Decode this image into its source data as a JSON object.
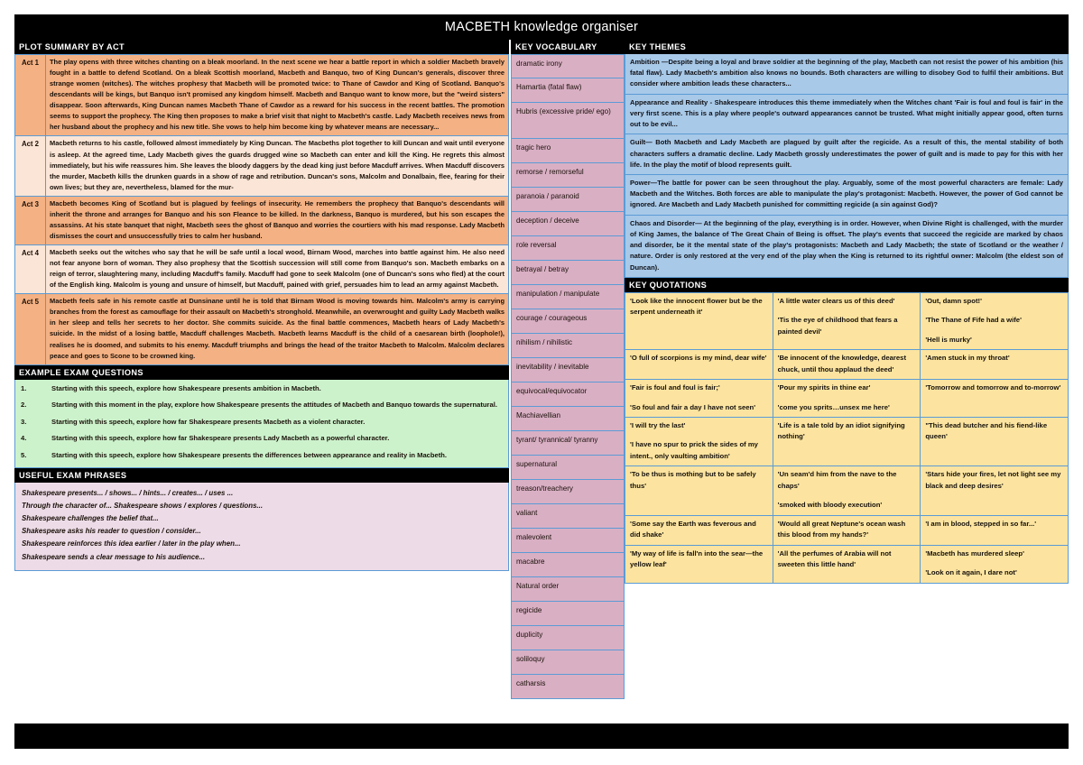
{
  "document": {
    "title": "MACBETH knowledge organiser"
  },
  "plot": {
    "heading": "PLOT SUMMARY BY ACT",
    "acts": [
      {
        "label": "Act 1",
        "text": "The play opens with three witches chanting on a bleak moorland. In the next scene we hear a battle report in which a soldier Macbeth bravely fought in a battle to defend Scotland. On a bleak Scottish moorland, Macbeth and Banquo, two of King Duncan's generals, discover three strange women (witches). The witches prophesy that Macbeth will be promoted twice: to Thane of Cawdor and King of Scotland. Banquo's descendants will be kings, but Banquo isn't promised any kingdom himself. Macbeth and Banquo want to know more, but the \"weird sisters\" disappear. Soon afterwards, King Duncan names Macbeth Thane of Cawdor as a reward for his success in the recent battles. The promotion seems to support the prophecy. The King then proposes to make a brief visit that night to Macbeth's castle. Lady Macbeth receives news from her husband about the prophecy and his new title. She vows to help him become king by whatever means are necessary..."
      },
      {
        "label": "Act 2",
        "text": "Macbeth returns to his castle, followed almost immediately by King Duncan. The Macbeths plot together to kill Duncan and wait until everyone is asleep. At the agreed time, Lady Macbeth gives the guards drugged wine so Macbeth can enter and kill the King. He regrets this almost immediately, but his wife reassures him. She leaves the bloody daggers by the dead king just before Macduff arrives. When Macduff discovers the murder, Macbeth kills the drunken guards in a show of rage and retribution. Duncan's sons, Malcolm and Donalbain, flee, fearing for their own lives; but they are, nevertheless, blamed for the mur-"
      },
      {
        "label": "Act 3",
        "text": "Macbeth becomes King of Scotland but is plagued by feelings of insecurity. He remembers the prophecy that Banquo's descendants will inherit the throne and arranges for Banquo and his son Fleance to be killed. In the darkness, Banquo is murdered, but his son escapes the assassins. At his state banquet that night, Macbeth sees the ghost of Banquo and worries the courtiers with his mad response. Lady Macbeth dismisses the court and unsuccessfully tries to calm her husband."
      },
      {
        "label": "Act 4",
        "text": "Macbeth seeks out the witches who say that he will be safe until a local wood, Birnam Wood, marches into battle against him. He also need not fear anyone born of woman. They also prophesy that the Scottish succession will still come from Banquo's son. Macbeth embarks on a reign of terror, slaughtering many, including Macduff's family. Macduff had gone to seek Malcolm (one of Duncan's sons who fled) at the court of the English king. Malcolm is young and unsure of himself, but Macduff, pained with grief, persuades him to lead an army against Macbeth."
      },
      {
        "label": "Act 5",
        "text": "Macbeth feels safe in his remote castle at Dunsinane until he is told that Birnam Wood is moving towards him. Malcolm's army is carrying branches from the forest as camouflage for their assault on Macbeth's stronghold. Meanwhile, an overwrought and guilty Lady Macbeth walks in her sleep and tells her secrets to her doctor. She commits suicide. As the final battle commences, Macbeth hears of Lady Macbeth's suicide. In the midst of a losing battle, Macduff challenges Macbeth. Macbeth learns Macduff is the child of a caesarean birth (loophole!), realises he is doomed, and submits to his enemy. Macduff triumphs and brings the head of the traitor Macbeth to Malcolm. Malcolm declares peace and goes to Scone to be crowned king."
      }
    ]
  },
  "exam_questions": {
    "heading": "EXAMPLE EXAM QUESTIONS",
    "items": [
      {
        "num": "1.",
        "text": "Starting with this speech, explore how Shakespeare presents ambition in Macbeth."
      },
      {
        "num": "2.",
        "text": "Starting with this moment in the play, explore how Shakespeare presents the attitudes of Macbeth and Banquo towards the supernatural."
      },
      {
        "num": "3.",
        "text": "Starting with this speech, explore how far Shakespeare presents Macbeth as a violent character."
      },
      {
        "num": "4.",
        "text": "Starting with this speech, explore how far Shakespeare presents Lady Macbeth as a powerful character."
      },
      {
        "num": "5.",
        "text": "Starting with this speech, explore how Shakespeare presents the differences between appearance and reality in Macbeth."
      }
    ]
  },
  "useful_phrases": {
    "heading": "USEFUL EXAM PHRASES",
    "lines": [
      "Shakespeare presents... / shows... / hints... / creates... / uses ...",
      "Through the character of... Shakespeare shows / explores / questions...",
      "Shakespeare challenges the belief that...",
      "Shakespeare asks his reader to question / consider...",
      "Shakespeare reinforces this idea earlier / later in the play when...",
      "Shakespeare sends a clear message to his audience..."
    ]
  },
  "vocabulary": {
    "heading": "KEY VOCABULARY",
    "terms": [
      "dramatic irony",
      "Hamartia (fatal flaw)",
      "Hubris (excessive pride/ ego)",
      "tragic hero",
      "remorse / remorseful",
      "paranoia / paranoid",
      "deception / deceive",
      "role reversal",
      "betrayal / betray",
      "manipulation / manipulate",
      "courage / courageous",
      "nihilism / nihilistic",
      "inevitability / inevitable",
      "equivocal/equivocator",
      "Machiavellian",
      "tyrant/ tyrannical/ tyranny",
      "supernatural",
      "treason/treachery",
      "valiant",
      "malevolent",
      "macabre",
      "Natural order",
      "regicide",
      "duplicity",
      "soliloquy",
      "catharsis"
    ]
  },
  "themes": {
    "heading": "KEY THEMES",
    "items": [
      "Ambition —Despite being a loyal and brave soldier at the beginning of the play, Macbeth can not resist the power of his ambition (his fatal flaw). Lady Macbeth's ambition also knows no bounds.  Both characters are willing to disobey God to fulfil their ambitions. But consider where ambition leads these characters...",
      "Appearance and Reality  - Shakespeare introduces this theme immediately when the Witches chant 'Fair is foul and foul is fair' in the very first scene. This is a play where people's outward appearances cannot be trusted.  What might initially appear good, often turns out to be evil...",
      "Guilt— Both Macbeth and Lady Macbeth are plagued by guilt after the regicide.  As a result of this, the mental stability of both characters suffers a dramatic decline.  Lady Macbeth grossly underestimates the power of guilt  and is made to pay for this with her life. In the play the motif of blood represents guilt.",
      "Power—The battle for power can be seen throughout the play.  Arguably, some of the most powerful characters are female: Lady Macbeth and the Witches.  Both forces are able to manipulate the play's protagonist: Macbeth.  However, the power of God cannot be ignored.  Are Macbeth and Lady Macbeth punished for committing regicide (a sin against God)?",
      "Chaos and Disorder— At the beginning of the play, everything is in order.  However, when Divine Right is challenged, with the murder of King James, the balance of The Great Chain of Being is offset. The play's events  that succeed the regicide are marked by chaos and disorder, be it the mental state of the play's protagonists: Macbeth and Lady Macbeth; the state of Scotland or the weather / nature.  Order is only restored at the very end of the play when the King is returned to its rightful owner: Malcolm (the eldest son of Duncan)."
    ]
  },
  "quotations": {
    "heading": "KEY QUOTATIONS",
    "rows": [
      [
        [
          "'Look like the innocent flower but be the serpent underneath it'"
        ],
        [
          "'A little water clears us of this deed'",
          "'Tis the eye of childhood that fears a painted devil'"
        ],
        [
          "'Out, damn spot!'",
          "'The Thane of Fife had a wife'",
          "'Hell is murky'"
        ]
      ],
      [
        [
          "'O full of scorpions is my mind, dear wife'"
        ],
        [
          "'Be innocent of the knowledge, dearest chuck, until thou applaud the deed'"
        ],
        [
          "'Amen stuck in my throat'"
        ]
      ],
      [
        [
          "'Fair is foul and foul is fair;'",
          "'So foul and fair a day I have not seen'"
        ],
        [
          "'Pour my spirits in thine ear'",
          "'come you sprits…unsex me here'"
        ],
        [
          "'Tomorrow and tomorrow and to-morrow'"
        ]
      ],
      [
        [
          "'I will try the last'",
          "'I have no spur to prick the sides of my intent., only vaulting ambition'"
        ],
        [
          "'Life is a tale told by an idiot signifying nothing'"
        ],
        [
          "\"This dead butcher and his fiend-like queen'"
        ]
      ],
      [
        [
          "'To be thus is mothing but to be safely thus'"
        ],
        [
          "'Un seam'd him from the nave to the chaps'",
          "'smoked with bloody execution'"
        ],
        [
          "'Stars hide your fires, let not light see my black and deep desires'"
        ]
      ],
      [
        [
          "'Some say the Earth was feverous and did shake'"
        ],
        [
          "'Would all great Neptune's ocean wash this blood from my hands?'"
        ],
        [
          "'I am in blood, stepped in so far...'"
        ]
      ],
      [
        [
          "'My way of life is fall'n into the sear—the yellow leaf'"
        ],
        [
          "'All the perfumes of Arabia will not sweeten this little hand'"
        ],
        [
          "'Macbeth has murdered sleep'",
          "'Look on it again, I dare not'"
        ]
      ]
    ]
  },
  "colors": {
    "header_bar": "#000000",
    "act_dark": "#F4B183",
    "act_light": "#FBE5D6",
    "exam_green": "#CCF2CC",
    "phrases_pink": "#EDDCE8",
    "vocab_pink": "#D9AFC4",
    "theme_blue": "#A8C9E8",
    "quote_yellow": "#FCE4A0",
    "border_blue": "#5B9BD5"
  }
}
